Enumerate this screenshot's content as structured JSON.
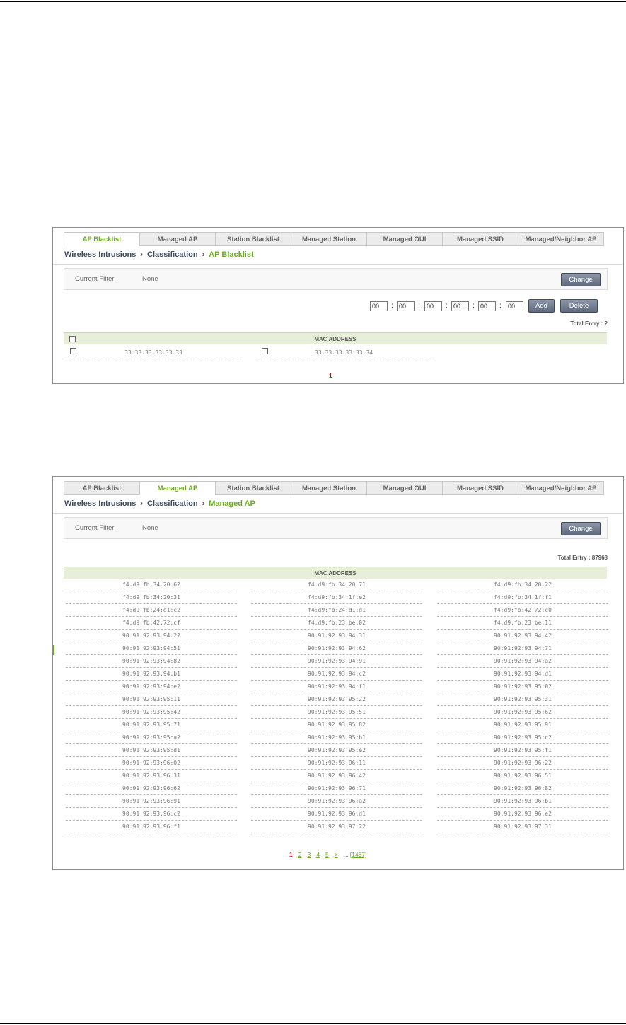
{
  "panel1": {
    "tabs": [
      "AP Blacklist",
      "Managed AP",
      "Station Blacklist",
      "Managed Station",
      "Managed OUI",
      "Managed SSID",
      "Managed/Neighbor AP"
    ],
    "active_tab": 0,
    "breadcrumb": {
      "a": "Wireless Intrusions",
      "b": "Classification",
      "c": "AP Blacklist"
    },
    "filter": {
      "label": "Current Filter :",
      "value": "None",
      "change_label": "Change"
    },
    "mac_inputs": [
      "00",
      "00",
      "00",
      "00",
      "00",
      "00"
    ],
    "add_label": "Add",
    "delete_label": "Delete",
    "total_entry": "Total Entry : 2",
    "table_header": "MAC ADDRESS",
    "rows": [
      "33:33:33:33:33:33",
      "33:33:33:33:33:34"
    ],
    "page": "1"
  },
  "panel2": {
    "tabs": [
      "AP Blacklist",
      "Managed AP",
      "Station Blacklist",
      "Managed Station",
      "Managed OUI",
      "Managed SSID",
      "Managed/Neighbor AP"
    ],
    "active_tab": 1,
    "breadcrumb": {
      "a": "Wireless Intrusions",
      "b": "Classification",
      "c": "Managed AP"
    },
    "filter": {
      "label": "Current Filter :",
      "value": "None",
      "change_label": "Change"
    },
    "total_entry": "Total Entry : 87968",
    "table_header": "MAC ADDRESS",
    "rows": [
      [
        "f4:d9:fb:34:20:62",
        "f4:d9:fb:34:20:71",
        "f4:d9:fb:34:20:22"
      ],
      [
        "f4:d9:fb:34:20:31",
        "f4:d9:fb:34:1f:e2",
        "f4:d9:fb:34:1f:f1"
      ],
      [
        "f4:d9:fb:24:d1:c2",
        "f4:d9:fb:24:d1:d1",
        "f4:d9:fb:42:72:c0"
      ],
      [
        "f4:d9:fb:42:72:cf",
        "f4:d9:fb:23:be:02",
        "f4:d9:fb:23:be:11"
      ],
      [
        "90:91:92:93:94:22",
        "90:91:92:93:94:31",
        "90:91:92:93:94:42"
      ],
      [
        "90:91:92:93:94:51",
        "90:91:92:93:94:62",
        "90:91:92:93:94:71"
      ],
      [
        "90:91:92:93:94:82",
        "90:91:92:93:94:91",
        "90:91:92:93:94:a2"
      ],
      [
        "90:91:92:93:94:b1",
        "90:91:92:93:94:c2",
        "90:91:92:93:94:d1"
      ],
      [
        "90:91:92:93:94:e2",
        "90:91:92:93:94:f1",
        "90:91:92:93:95:02"
      ],
      [
        "90:91:92:93:95:11",
        "90:91:92:93:95:22",
        "90:91:92:93:95:31"
      ],
      [
        "90:91:92:93:95:42",
        "90:91:92:93:95:51",
        "90:91:92:93:95:62"
      ],
      [
        "90:91:92:93:95:71",
        "90:91:92:93:95:82",
        "90:91:92:93:95:91"
      ],
      [
        "90:91:92:93:95:a2",
        "90:91:92:93:95:b1",
        "90:91:92:93:95:c2"
      ],
      [
        "90:91:92:93:95:d1",
        "90:91:92:93:95:e2",
        "90:91:92:93:95:f1"
      ],
      [
        "90:91:92:93:96:02",
        "90:91:92:93:96:11",
        "90:91:92:93:96:22"
      ],
      [
        "90:91:92:93:96:31",
        "90:91:92:93:96:42",
        "90:91:92:93:96:51"
      ],
      [
        "90:91:92:93:96:62",
        "90:91:92:93:96:71",
        "90:91:92:93:96:82"
      ],
      [
        "90:91:92:93:96:91",
        "90:91:92:93:96:a2",
        "90:91:92:93:96:b1"
      ],
      [
        "90:91:92:93:96:c2",
        "90:91:92:93:96:d1",
        "90:91:92:93:96:e2"
      ],
      [
        "90:91:92:93:96:f1",
        "90:91:92:93:97:22",
        "90:91:92:93:97:31"
      ]
    ],
    "pages": [
      "1",
      "2",
      "3",
      "4",
      "5",
      ">"
    ],
    "ellipsis": "...",
    "last_page": "[1467]"
  },
  "colors": {
    "accent_green": "#6aaa23",
    "current_page_red": "#cc1111",
    "button": "#6b768a"
  }
}
